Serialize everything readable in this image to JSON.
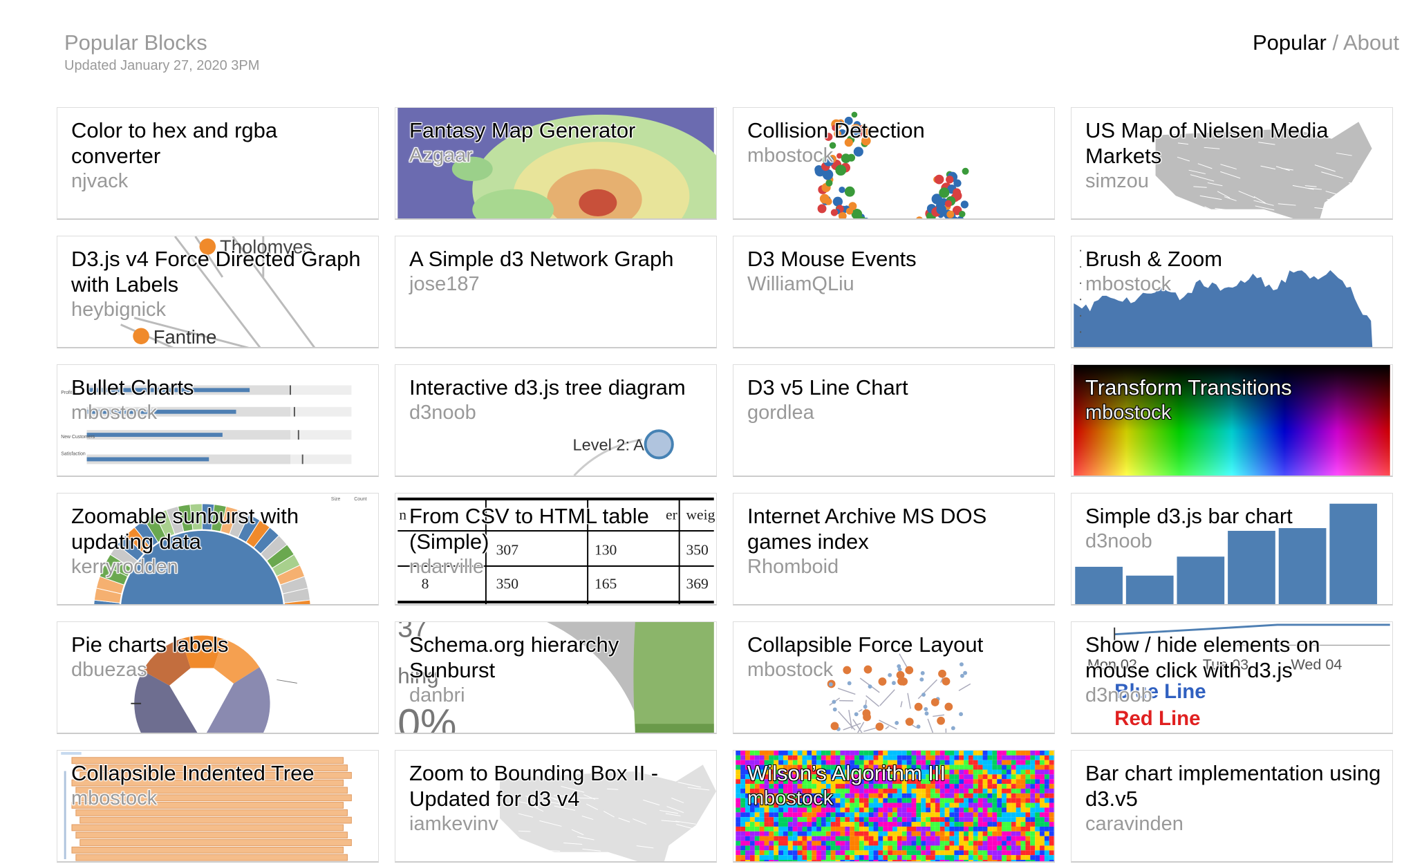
{
  "header": {
    "title": "Popular Blocks",
    "updated": "Updated January 27, 2020 3PM"
  },
  "nav": {
    "popular": "Popular",
    "separator": " / ",
    "about": "About"
  },
  "blocks": [
    {
      "title": "Color to hex and rgba converter",
      "author": "njvack",
      "thumb": "none"
    },
    {
      "title": "Fantasy Map Generator",
      "author": "Azgaar",
      "thumb": "fantasy-map"
    },
    {
      "title": "Collision Detection",
      "author": "mbostock",
      "thumb": "collision-dots"
    },
    {
      "title": "US Map of Nielsen Media Markets",
      "author": "simzou",
      "thumb": "us-map-gray"
    },
    {
      "title": "D3.js v4 Force Directed Graph with Labels",
      "author": "heybignick",
      "thumb": "force-labels",
      "thumb_labels": [
        "Tholomyes",
        "Fantine"
      ]
    },
    {
      "title": "A Simple d3 Network Graph",
      "author": "jose187",
      "thumb": "none"
    },
    {
      "title": "D3 Mouse Events",
      "author": "WilliamQLiu",
      "thumb": "none"
    },
    {
      "title": "Brush & Zoom",
      "author": "mbostock",
      "thumb": "area-chart"
    },
    {
      "title": "Bullet Charts",
      "author": "mbostock",
      "thumb": "bullet-charts",
      "thumb_labels": [
        "Profit",
        "New Customers",
        "Satisfaction"
      ]
    },
    {
      "title": "Interactive d3.js tree diagram",
      "author": "d3noob",
      "thumb": "tree-node",
      "thumb_labels": [
        "Level 2: A"
      ]
    },
    {
      "title": "D3 v5 Line Chart",
      "author": "gordlea",
      "thumb": "none"
    },
    {
      "title": "Transform Transitions",
      "author": "mbostock",
      "thumb": "color-spectrum"
    },
    {
      "title": "Zoomable sunburst with updating data",
      "author": "kerryrodden",
      "thumb": "sunburst",
      "thumb_labels": [
        "Size",
        "Count"
      ]
    },
    {
      "title": "From CSV to HTML table (Simple)",
      "author": "ndarville",
      "thumb": "html-table",
      "thumb_labels": [
        "n",
        "er",
        "weig",
        "8",
        "307",
        "130",
        "350",
        "350",
        "165",
        "369"
      ]
    },
    {
      "title": "Internet Archive MS DOS games index",
      "author": "Rhomboid",
      "thumb": "none"
    },
    {
      "title": "Simple d3.js bar chart",
      "author": "d3noob",
      "thumb": "bar-chart"
    },
    {
      "title": "Pie charts labels",
      "author": "dbuezas",
      "thumb": "donut"
    },
    {
      "title": "Schema.org hierarchy Sunburst",
      "author": "danbri",
      "thumb": "schema-sunburst",
      "thumb_labels": [
        "37",
        "hing",
        "0%"
      ]
    },
    {
      "title": "Collapsible Force Layout",
      "author": "mbostock",
      "thumb": "force-clusters"
    },
    {
      "title": "Show / hide elements on mouse click with d3.js",
      "author": "d3noob",
      "thumb": "show-hide-lines",
      "thumb_labels": [
        "Mon 02",
        "Tue 03",
        "Wed 04",
        "Blue Line",
        "Red Line"
      ]
    },
    {
      "title": "Collapsible Indented Tree",
      "author": "mbostock",
      "thumb": "indented-tree"
    },
    {
      "title": "Zoom to Bounding Box II - Updated for d3 v4",
      "author": "iamkevinv",
      "thumb": "us-map-light"
    },
    {
      "title": "Wilson’s Algorithm III",
      "author": "mbostock",
      "thumb": "wilson-maze"
    },
    {
      "title": "Bar chart implementation using d3.v5",
      "author": "caravinden",
      "thumb": "none"
    }
  ],
  "colors": {
    "muted_text": "#999999",
    "card_border": "#dddddd",
    "d3_blue": "#4e7fb3",
    "d3_orange": "#f08a2b",
    "fantasy_bg": "#6b6bb0"
  }
}
